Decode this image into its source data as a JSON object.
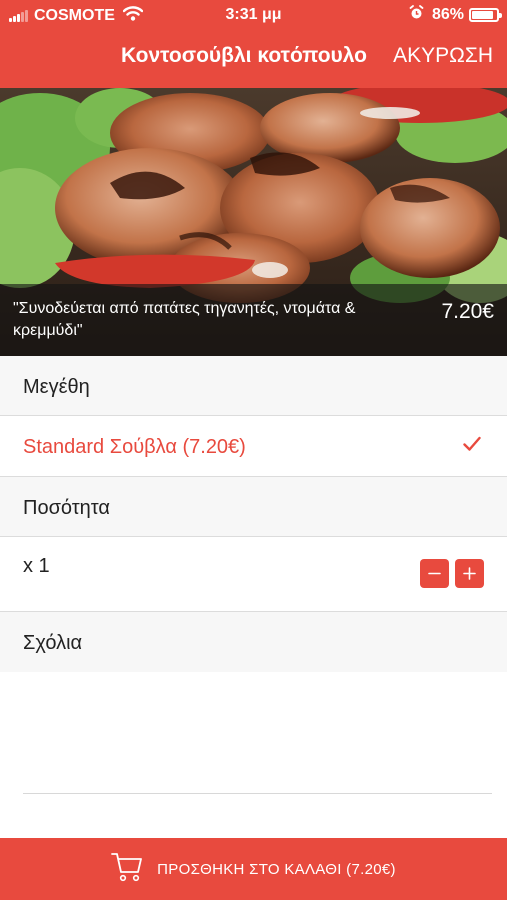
{
  "status_bar": {
    "carrier": "COSMOTE",
    "time": "3:31 μμ",
    "battery_percent": "86%",
    "battery_level": 0.86,
    "signal_bars_filled": 3,
    "icons": [
      "signal-icon",
      "wifi-icon",
      "alarm-icon",
      "battery-icon"
    ]
  },
  "nav": {
    "title": "Κοντοσούβλι κοτόπουλο",
    "cancel_label": "ΑΚΥΡΩΣΗ"
  },
  "product": {
    "description": "\"Συνοδεύεται από πατάτες τηγανητές, ντομάτα & κρεμμύδι\"",
    "price": "7.20€"
  },
  "sizes": {
    "header": "Μεγέθη",
    "options": [
      {
        "label": "Standard Σούβλα (7.20€)",
        "selected": true
      }
    ]
  },
  "quantity": {
    "header": "Ποσότητα",
    "value_label": "x 1",
    "decrement_icon": "minus-icon",
    "increment_icon": "plus-icon"
  },
  "comments": {
    "header": "Σχόλια",
    "value": ""
  },
  "cart": {
    "label": "ΠΡΟΣΘΗΚΗ ΣΤΟ ΚΑΛΑΘΙ (7.20€)",
    "icon": "cart-icon"
  },
  "colors": {
    "accent": "#e84a3e",
    "section_bg": "#f7f7f7",
    "divider": "#dcdcdc"
  }
}
